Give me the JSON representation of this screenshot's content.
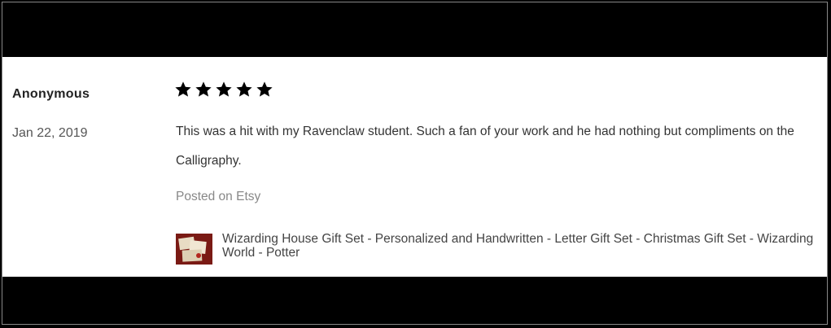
{
  "review": {
    "reviewer": "Anonymous",
    "date": "Jan 22, 2019",
    "rating": 5,
    "rating_max": 5,
    "text": "This was a hit with my Ravenclaw student. Such a fan of your work and he had nothing but compliments on the Calligraphy.",
    "posted_on": "Posted on Etsy",
    "product": {
      "title": "Wizarding House Gift Set - Personalized and Handwritten - Letter Gift Set - Christmas Gift Set - Wizarding World - Potter",
      "thumbnail_icon": "product-thumbnail-letters"
    },
    "star_color": "#000000"
  }
}
